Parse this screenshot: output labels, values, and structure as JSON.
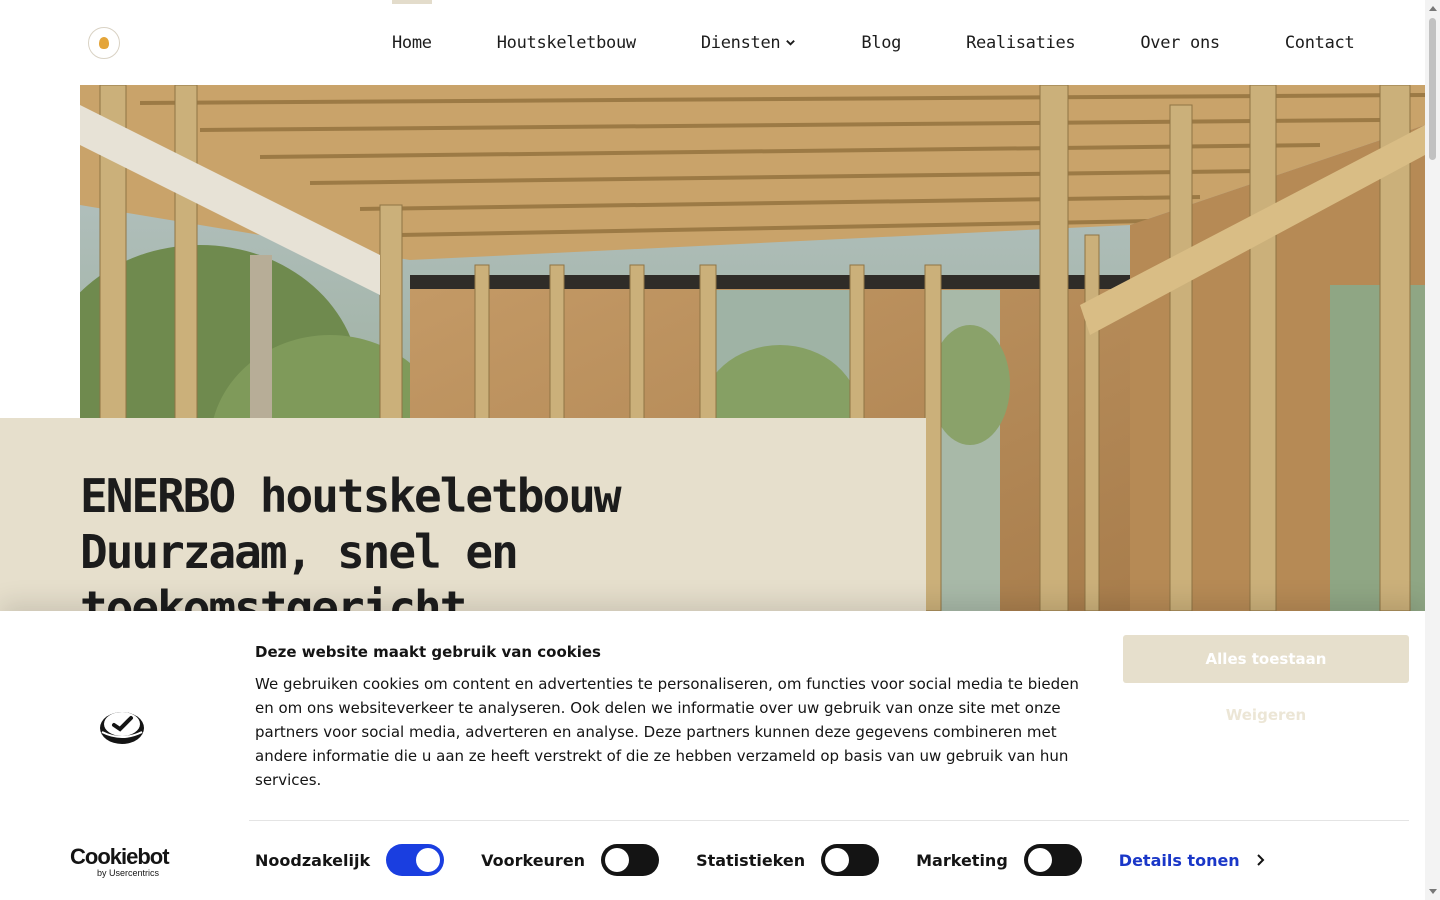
{
  "header": {
    "logo_icon": "enerbo-flame-logo",
    "nav": [
      {
        "label": "Home",
        "active": true
      },
      {
        "label": "Houtskeletbouw"
      },
      {
        "label": "Diensten",
        "has_dropdown": true
      },
      {
        "label": "Blog"
      },
      {
        "label": "Realisaties"
      },
      {
        "label": "Over ons"
      },
      {
        "label": "Contact"
      }
    ]
  },
  "hero": {
    "image": "timber-frame-construction-photo",
    "title_lines": [
      "ENERBO houtskeletbouw",
      "Duurzaam, snel en",
      "toekomstgericht"
    ]
  },
  "cookie_banner": {
    "title": "Deze website maakt gebruik van cookies",
    "text": "We gebruiken cookies om content en advertenties te personaliseren, om functies voor social media te bieden en om ons websiteverkeer te analyseren. Ook delen we informatie over uw gebruik van onze site met onze partners voor social media, adverteren en analyse. Deze partners kunnen deze gegevens combineren met andere informatie die u aan ze heeft verstrekt of die ze hebben verzameld op basis van uw gebruik van hun services.",
    "allow_all": "Alles toestaan",
    "deny": "Weigeren",
    "brand": {
      "name": "Cookiebot",
      "by": "by Usercentrics"
    },
    "consents": [
      {
        "label": "Noodzakelijk",
        "on": true
      },
      {
        "label": "Voorkeuren",
        "on": false
      },
      {
        "label": "Statistieken",
        "on": false
      },
      {
        "label": "Marketing",
        "on": false
      }
    ],
    "details_label": "Details tonen"
  },
  "colors": {
    "beige": "#e6dfcc",
    "toggle_on": "#1a3ee0",
    "link_blue": "#1a37c8",
    "text": "#1c1c1c"
  }
}
